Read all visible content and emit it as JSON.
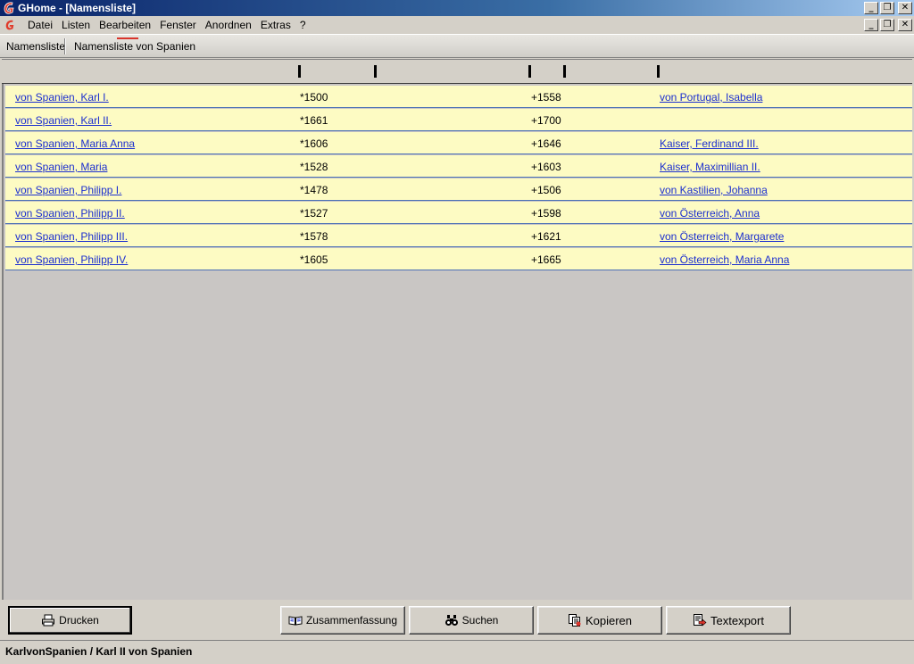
{
  "window": {
    "title": "GHome - [Namensliste]",
    "buttons": {
      "minimize": "_",
      "restore": "❐",
      "close": "✕"
    }
  },
  "menu": {
    "items": [
      "Datei",
      "Listen",
      "Bearbeiten",
      "Fenster",
      "Anordnen",
      "Extras",
      "?"
    ]
  },
  "tabs": [
    {
      "label": "Namensliste"
    },
    {
      "label": "Namensliste von Spanien"
    }
  ],
  "table": {
    "rows": [
      {
        "name": "von Spanien, Karl I.",
        "birth": "*1500",
        "death": "+1558",
        "spouse": "von Portugal, Isabella"
      },
      {
        "name": "von Spanien, Karl II.",
        "birth": "*1661",
        "death": "+1700",
        "spouse": ""
      },
      {
        "name": "von Spanien, Maria Anna",
        "birth": "*1606",
        "death": "+1646",
        "spouse": "Kaiser, Ferdinand III."
      },
      {
        "name": "von Spanien, Maria",
        "birth": "*1528",
        "death": "+1603",
        "spouse": "Kaiser, Maximillian II."
      },
      {
        "name": "von Spanien, Philipp I.",
        "birth": "*1478",
        "death": "+1506",
        "spouse": "von Kastilien, Johanna"
      },
      {
        "name": "von Spanien, Philipp II.",
        "birth": "*1527",
        "death": "+1598",
        "spouse": "von Österreich, Anna"
      },
      {
        "name": "von Spanien, Philipp III.",
        "birth": "*1578",
        "death": "+1621",
        "spouse": "von Österreich, Margarete"
      },
      {
        "name": "von Spanien, Philipp IV.",
        "birth": "*1605",
        "death": "+1665",
        "spouse": "von Österreich, Maria Anna"
      }
    ]
  },
  "buttons": {
    "print": "Drucken",
    "summary": "Zusammenfassung",
    "search": "Suchen",
    "copy": "Kopieren",
    "export": "Textexport"
  },
  "status": {
    "text": "KarlvonSpanien / Karl II von Spanien"
  },
  "colors": {
    "link": "#1c2fcf",
    "row_bg": "#fdfbc3",
    "row_border": "#4a6fb5",
    "accent": "#d9342b"
  }
}
